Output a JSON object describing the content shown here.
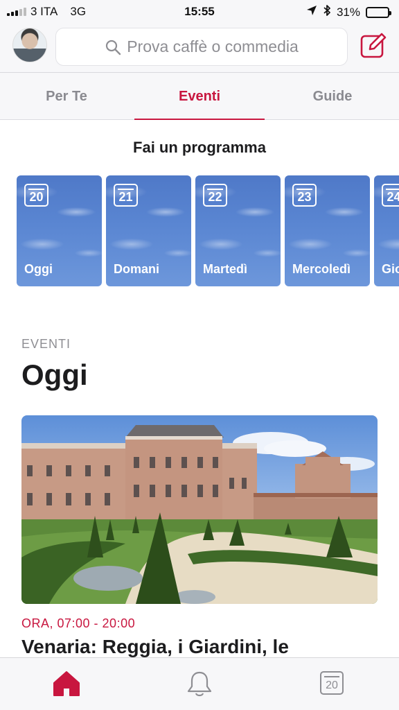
{
  "status_bar": {
    "carrier": "3 ITA",
    "network": "3G",
    "time": "15:55",
    "battery_percent": "31%",
    "battery_level": 0.31,
    "icons": [
      "signal-icon",
      "location-arrow-icon",
      "bluetooth-icon",
      "battery-icon"
    ]
  },
  "header": {
    "avatar": "avatar",
    "search_placeholder": "Prova caffè o commedia",
    "compose_icon": "compose-icon"
  },
  "tabs": [
    {
      "label": "Per Te",
      "active": false
    },
    {
      "label": "Eventi",
      "active": true
    },
    {
      "label": "Guide",
      "active": false
    }
  ],
  "programma": {
    "title": "Fai un programma",
    "days": [
      {
        "number": "20",
        "label": "Oggi"
      },
      {
        "number": "21",
        "label": "Domani"
      },
      {
        "number": "22",
        "label": "Martedì"
      },
      {
        "number": "23",
        "label": "Mercoledì"
      },
      {
        "number": "24",
        "label": "Gio"
      }
    ]
  },
  "events_section": {
    "kicker": "EVENTI",
    "title": "Oggi",
    "event": {
      "time": "ORA, 07:00 - 20:00",
      "title": "Venaria: Reggia, i Giardini, le"
    }
  },
  "tab_bar": {
    "items": [
      {
        "name": "home-icon",
        "active": true
      },
      {
        "name": "bell-icon",
        "active": false
      },
      {
        "name": "calendar-icon",
        "active": false,
        "number": "20"
      }
    ]
  },
  "colors": {
    "accent": "#c8163f",
    "inactive": "#8e8e93",
    "card_sky": "#5a86d2"
  }
}
